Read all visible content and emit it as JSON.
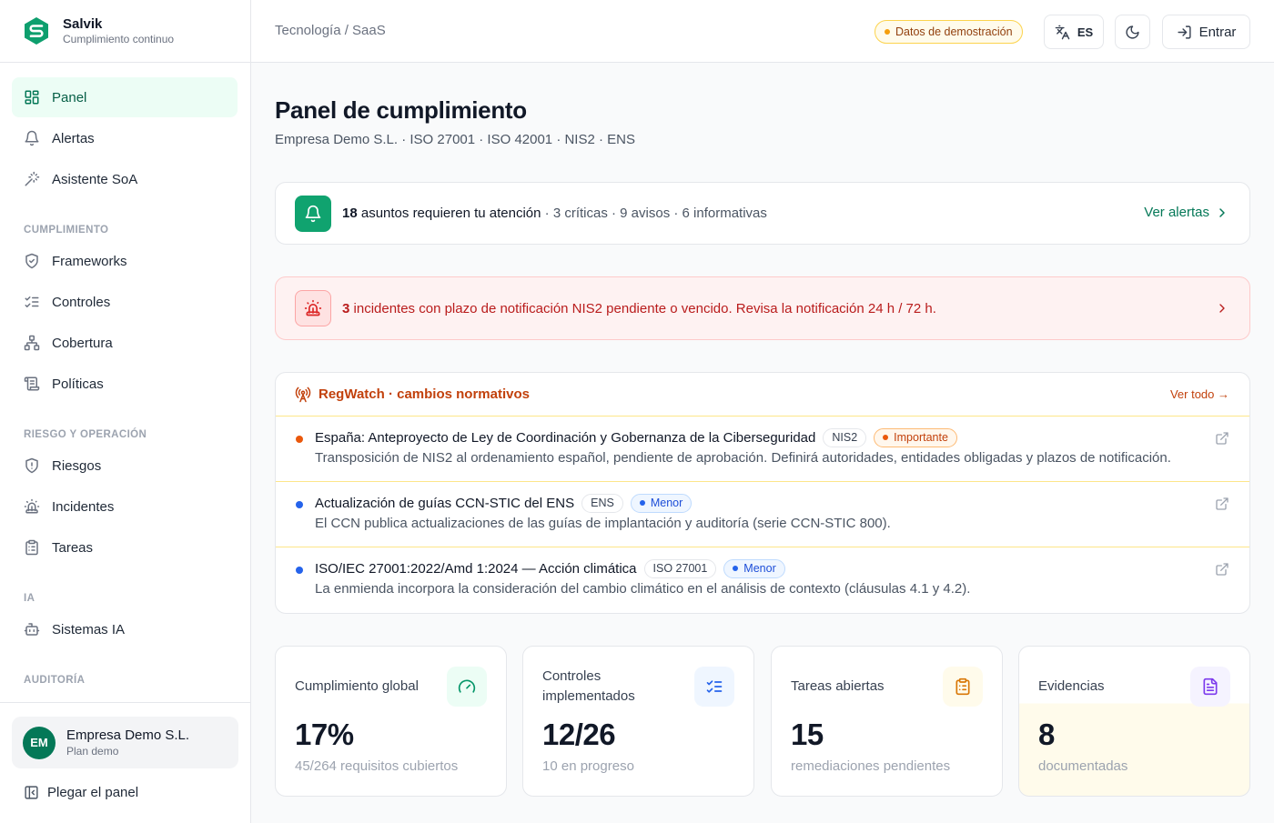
{
  "brand": {
    "name": "Salvik",
    "tagline": "Cumplimiento continuo"
  },
  "sidebar": {
    "items": [
      {
        "label": "Panel",
        "icon": "grid-icon",
        "active": true
      },
      {
        "label": "Alertas",
        "icon": "bell-icon"
      },
      {
        "label": "Asistente SoA",
        "icon": "magic-wand-icon"
      }
    ],
    "sections": [
      {
        "title": "CUMPLIMIENTO",
        "items": [
          {
            "label": "Frameworks",
            "icon": "shield-check-icon"
          },
          {
            "label": "Controles",
            "icon": "list-checks-icon"
          },
          {
            "label": "Cobertura",
            "icon": "network-icon"
          },
          {
            "label": "Políticas",
            "icon": "scroll-icon"
          }
        ]
      },
      {
        "title": "RIESGO Y OPERACIÓN",
        "items": [
          {
            "label": "Riesgos",
            "icon": "shield-alert-icon"
          },
          {
            "label": "Incidentes",
            "icon": "siren-icon"
          },
          {
            "label": "Tareas",
            "icon": "clipboard-icon"
          }
        ]
      },
      {
        "title": "IA",
        "items": [
          {
            "label": "Sistemas IA",
            "icon": "bot-icon"
          }
        ]
      },
      {
        "title": "AUDITORÍA",
        "items": []
      }
    ],
    "org": {
      "initials": "EM",
      "name": "Empresa Demo S.L.",
      "plan": "Plan demo"
    },
    "collapse_label": "Plegar el panel"
  },
  "header": {
    "breadcrumb": "Tecnología / SaaS",
    "demo_badge": "Datos de demostración",
    "lang": "ES",
    "login": "Entrar"
  },
  "page": {
    "title": "Panel de cumplimiento",
    "subtitle": "Empresa Demo S.L. · ISO 27001 · ISO 42001 · NIS2 · ENS"
  },
  "attention": {
    "count": "18",
    "text": "asuntos requieren tu atención",
    "detail": " · 3 críticas · 9 avisos · 6 informativas",
    "link": "Ver alertas"
  },
  "nis2_alert": {
    "count": "3",
    "text": "incidentes con plazo de notificación NIS2 pendiente o vencido. Revisa la notificación 24 h / 72 h."
  },
  "regwatch": {
    "title": "RegWatch · cambios normativos",
    "view_all": "Ver todo →",
    "items": [
      {
        "title": "España: Anteproyecto de Ley de Coordinación y Gobernanza de la Ciberseguridad",
        "tag": "NIS2",
        "severity": "Importante",
        "severity_color": "#ea580c",
        "desc": "Transposición de NIS2 al ordenamiento español, pendiente de aprobación. Definirá autoridades, entidades obligadas y plazos de notificación."
      },
      {
        "title": "Actualización de guías CCN-STIC del ENS",
        "tag": "ENS",
        "severity": "Menor",
        "severity_color": "#2563eb",
        "desc": "El CCN publica actualizaciones de las guías de implantación y auditoría (serie CCN-STIC 800)."
      },
      {
        "title": "ISO/IEC 27001:2022/Amd 1:2024 — Acción climática",
        "tag": "ISO 27001",
        "severity": "Menor",
        "severity_color": "#2563eb",
        "desc": "La enmienda incorpora la consideración del cambio climático en el análisis de contexto (cláusulas 4.1 y 4.2)."
      }
    ]
  },
  "stats": [
    {
      "label": "Cumplimiento global",
      "value": "17%",
      "foot": "45/264 requisitos cubiertos",
      "icon": "gauge-icon",
      "color": "#059669"
    },
    {
      "label": "Controles implementados",
      "value": "12/26",
      "foot": "10 en progreso",
      "icon": "list-checks-icon",
      "color": "#2563eb"
    },
    {
      "label": "Tareas abiertas",
      "value": "15",
      "foot": "remediaciones pendientes",
      "icon": "clipboard-icon",
      "color": "#d97706"
    },
    {
      "label": "Evidencias",
      "value": "8",
      "foot": "documentadas",
      "icon": "file-icon",
      "color": "#7c3aed"
    }
  ]
}
